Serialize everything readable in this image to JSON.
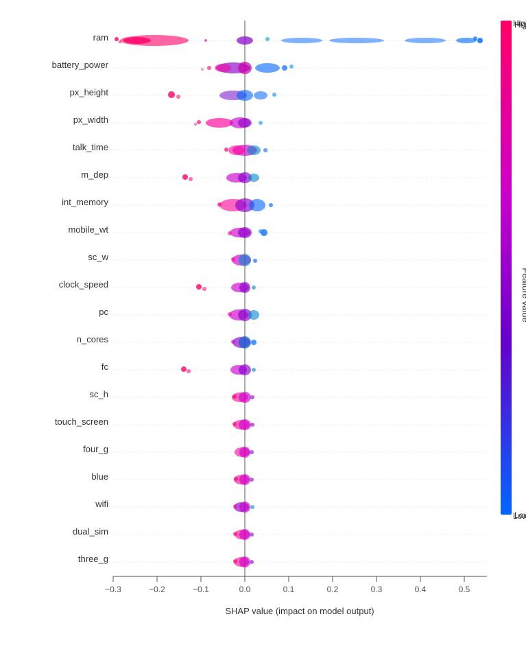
{
  "chart": {
    "title": "SHAP value (impact on model output)",
    "x_axis_label": "SHAP value (impact on model output)",
    "y_axis_label": "Feature value",
    "colorbar": {
      "high_label": "High",
      "low_label": "Low"
    },
    "features": [
      "ram",
      "battery_power",
      "px_height",
      "px_width",
      "talk_time",
      "m_dep",
      "int_memory",
      "mobile_wt",
      "sc_w",
      "clock_speed",
      "pc",
      "n_cores",
      "fc",
      "sc_h",
      "touch_screen",
      "four_g",
      "blue",
      "wifi",
      "dual_sim",
      "three_g"
    ],
    "x_ticks": [
      "-0.3",
      "-0.2",
      "-0.1",
      "0.0",
      "0.1",
      "0.2",
      "0.3",
      "0.4",
      "0.5"
    ],
    "accent_colors": {
      "pink": "#FF0066",
      "blue": "#0066FF",
      "purple": "#8800CC"
    }
  }
}
